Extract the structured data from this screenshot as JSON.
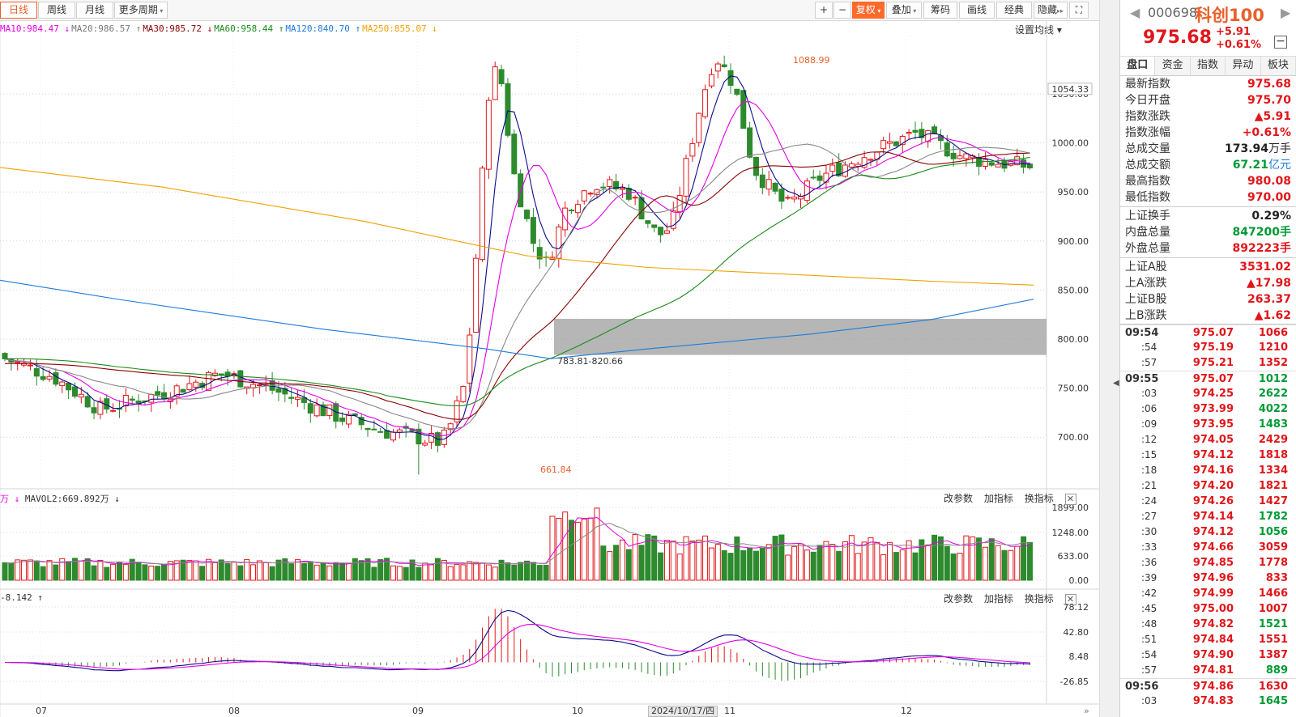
{
  "toolbar": {
    "period_tabs": [
      {
        "label": "日线",
        "active": true
      },
      {
        "label": "周线",
        "active": false
      },
      {
        "label": "月线",
        "active": false
      },
      {
        "label": "更多周期",
        "active": false,
        "dropdown": true
      }
    ],
    "right_buttons": [
      {
        "label": "+",
        "name": "zoom-in"
      },
      {
        "label": "−",
        "name": "zoom-out"
      },
      {
        "label": "复权",
        "name": "adjust",
        "dropdown": true
      },
      {
        "label": "叠加",
        "name": "overlay",
        "dropdown": true
      },
      {
        "label": "筹码",
        "name": "chips"
      },
      {
        "label": "画线",
        "name": "draw-line"
      },
      {
        "label": "经典",
        "name": "classic"
      },
      {
        "label": "隐藏",
        "name": "hide",
        "suffix": "▸▸"
      },
      {
        "label": "⛶",
        "name": "fullscreen"
      }
    ]
  },
  "ma_legend": [
    {
      "label": "MA10:984.47",
      "arrow": "↓",
      "color": "#e600e6"
    },
    {
      "label": "MA20:986.57",
      "arrow": "↑",
      "color": "#777777"
    },
    {
      "label": "MA30:985.72",
      "arrow": "↓",
      "color": "#8b0000"
    },
    {
      "label": "MA60:958.44",
      "arrow": "↑",
      "color": "#1a8a1a"
    },
    {
      "label": "MA120:840.70",
      "arrow": "↑",
      "color": "#1d7bdc"
    },
    {
      "label": "MA250:855.07",
      "arrow": "↓",
      "color": "#f0a000"
    }
  ],
  "ma_setting_label": "设置均线 ▾",
  "price_axis": {
    "ticks": [
      "1050.00",
      "1000.00",
      "950.00",
      "900.00",
      "850.00",
      "800.00",
      "750.00",
      "700.00"
    ],
    "current_label": "1054.33"
  },
  "annotations": {
    "high": "1088.99",
    "low": "661.84",
    "zone": "783.81-820.66"
  },
  "volume_panel": {
    "legend_prefix": "万",
    "legend": "MAVOL2:669.892万",
    "legend_arrow": "↓",
    "ticks": [
      "1899.00",
      "1248.00",
      "633.00",
      "0.00"
    ],
    "controls": [
      "改参数",
      "加指标",
      "换指标"
    ]
  },
  "macd_panel": {
    "legend": "-8.142",
    "legend_arrow": "↑",
    "ticks": [
      "78.12",
      "42.80",
      "8.48",
      "-26.85"
    ],
    "controls": [
      "改参数",
      "加指标",
      "换指标"
    ]
  },
  "x_axis": {
    "labels": [
      "07",
      "08",
      "09",
      "10",
      "11",
      "12"
    ],
    "cursor_date": "2024/10/17/四"
  },
  "chart_data": {
    "type": "candlestick",
    "price_ylim": [
      640,
      1095
    ],
    "high": 1088.99,
    "low": 661.84,
    "zone": [
      783.81,
      820.66
    ],
    "ma_latest": {
      "MA10": 984.47,
      "MA20": 986.57,
      "MA30": 985.72,
      "MA60": 958.44,
      "MA120": 840.7,
      "MA250": 855.07
    },
    "volume_ylim": [
      0,
      1899
    ],
    "macd_ylim": [
      -26.85,
      78.12
    ]
  },
  "side": {
    "code": "000698",
    "name": "科创100",
    "price": "975.68",
    "change": "+5.91",
    "change_pct": "+0.61%",
    "tabs": [
      "盘口",
      "资金",
      "指数",
      "异动",
      "板块"
    ],
    "info": [
      {
        "label": "最新指数",
        "value": "975.68",
        "cls": "up"
      },
      {
        "label": "今日开盘",
        "value": "975.70",
        "cls": "up"
      },
      {
        "label": "指数涨跌",
        "value": "▲5.91",
        "cls": "up"
      },
      {
        "label": "指数涨幅",
        "value": "+0.61%",
        "cls": "up"
      },
      {
        "label": "总成交量",
        "value": "173.94",
        "unit": "万手",
        "cls": "black"
      },
      {
        "label": "总成交额",
        "value": "67.21",
        "unit": "亿元",
        "cls": "down"
      },
      {
        "label": "最高指数",
        "value": "980.08",
        "cls": "up"
      },
      {
        "label": "最低指数",
        "value": "970.00",
        "cls": "up"
      }
    ],
    "info2": [
      {
        "label": "上证换手",
        "value": "0.29%",
        "cls": "black"
      },
      {
        "label": "内盘总量",
        "value": "847200手",
        "cls": "down"
      },
      {
        "label": "外盘总量",
        "value": "892223手",
        "cls": "up"
      }
    ],
    "info3": [
      {
        "label": "上证A股",
        "value": "3531.02",
        "cls": "up"
      },
      {
        "label": "上A涨跌",
        "value": "▲17.98",
        "cls": "up"
      },
      {
        "label": "上证B股",
        "value": "263.37",
        "cls": "up"
      },
      {
        "label": "上B涨跌",
        "value": "▲1.62",
        "cls": "up"
      }
    ],
    "ticks": [
      {
        "time": "09:54",
        "hour": true,
        "price": "975.07",
        "vol": "1066",
        "pc": "up",
        "vc": "up"
      },
      {
        "time": ":54",
        "price": "975.19",
        "vol": "1210",
        "pc": "up",
        "vc": "up"
      },
      {
        "time": ":57",
        "price": "975.21",
        "vol": "1352",
        "pc": "up",
        "vc": "up"
      },
      {
        "time": "09:55",
        "hour": true,
        "price": "975.07",
        "vol": "1012",
        "pc": "up",
        "vc": "down"
      },
      {
        "time": ":03",
        "price": "974.25",
        "vol": "2622",
        "pc": "up",
        "vc": "down"
      },
      {
        "time": ":06",
        "price": "973.99",
        "vol": "4022",
        "pc": "up",
        "vc": "down"
      },
      {
        "time": ":09",
        "price": "973.95",
        "vol": "1483",
        "pc": "up",
        "vc": "down"
      },
      {
        "time": ":12",
        "price": "974.05",
        "vol": "2429",
        "pc": "up",
        "vc": "up"
      },
      {
        "time": ":15",
        "price": "974.12",
        "vol": "1818",
        "pc": "up",
        "vc": "up"
      },
      {
        "time": ":18",
        "price": "974.16",
        "vol": "1334",
        "pc": "up",
        "vc": "up"
      },
      {
        "time": ":21",
        "price": "974.20",
        "vol": "1821",
        "pc": "up",
        "vc": "up"
      },
      {
        "time": ":24",
        "price": "974.26",
        "vol": "1427",
        "pc": "up",
        "vc": "up"
      },
      {
        "time": ":27",
        "price": "974.14",
        "vol": "1782",
        "pc": "up",
        "vc": "down"
      },
      {
        "time": ":30",
        "price": "974.12",
        "vol": "1056",
        "pc": "up",
        "vc": "down"
      },
      {
        "time": ":33",
        "price": "974.66",
        "vol": "3059",
        "pc": "up",
        "vc": "up"
      },
      {
        "time": ":36",
        "price": "974.85",
        "vol": "1778",
        "pc": "up",
        "vc": "up"
      },
      {
        "time": ":39",
        "price": "974.96",
        "vol": "833",
        "pc": "up",
        "vc": "up"
      },
      {
        "time": ":42",
        "price": "974.99",
        "vol": "1466",
        "pc": "up",
        "vc": "up"
      },
      {
        "time": ":45",
        "price": "975.00",
        "vol": "1007",
        "pc": "up",
        "vc": "up"
      },
      {
        "time": ":48",
        "price": "974.82",
        "vol": "1521",
        "pc": "up",
        "vc": "down"
      },
      {
        "time": ":51",
        "price": "974.84",
        "vol": "1551",
        "pc": "up",
        "vc": "up"
      },
      {
        "time": ":54",
        "price": "974.90",
        "vol": "1387",
        "pc": "up",
        "vc": "up"
      },
      {
        "time": ":57",
        "price": "974.81",
        "vol": "889",
        "pc": "up",
        "vc": "down"
      },
      {
        "time": "09:56",
        "hour": true,
        "price": "974.86",
        "vol": "1630",
        "pc": "up",
        "vc": "up"
      },
      {
        "time": ":03",
        "price": "974.83",
        "vol": "1645",
        "pc": "up",
        "vc": "down"
      }
    ]
  }
}
